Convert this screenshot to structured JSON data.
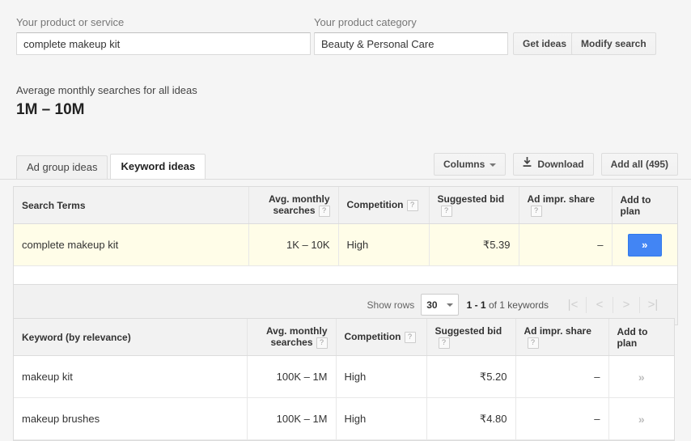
{
  "search_form": {
    "product_label": "Your product or service",
    "product_value": "complete makeup kit",
    "category_label": "Your product category",
    "category_value": "Beauty & Personal Care",
    "get_ideas_label": "Get ideas",
    "modify_search_label": "Modify search"
  },
  "summary": {
    "label": "Average monthly searches for all ideas",
    "value": "1M – 10M"
  },
  "tabs": [
    {
      "label": "Ad group ideas",
      "active": false
    },
    {
      "label": "Keyword ideas",
      "active": true
    }
  ],
  "toolbar": {
    "columns_label": "Columns",
    "download_label": "Download",
    "add_all_label": "Add all (495)"
  },
  "search_terms_table": {
    "columns": [
      "Search Terms",
      "Avg. monthly",
      "searches",
      "Competition",
      "Suggested bid",
      "Ad impr. share",
      "Add to plan"
    ],
    "help_glyph": "?",
    "rows": [
      {
        "keyword": "complete makeup kit",
        "avg_monthly_searches": "1K – 10K",
        "competition": "High",
        "suggested_bid": "₹5.39",
        "ad_impr_share": "–",
        "add_to_plan": "»"
      }
    ]
  },
  "pagination": {
    "show_rows_label": "Show rows",
    "rows_per_page": "30",
    "range_prefix": "1 - 1",
    "range_suffix": "of 1 keywords",
    "first_icon": "|<",
    "prev_icon": "<",
    "next_icon": ">",
    "last_icon": ">|"
  },
  "keyword_ideas_table": {
    "columns": [
      "Keyword (by relevance)",
      "Avg. monthly",
      "searches",
      "Competition",
      "Suggested bid",
      "Ad impr. share",
      "Add to plan"
    ],
    "help_glyph": "?",
    "rows": [
      {
        "keyword": "makeup kit",
        "avg_monthly_searches": "100K – 1M",
        "competition": "High",
        "suggested_bid": "₹5.20",
        "ad_impr_share": "–",
        "add_to_plan": "»"
      },
      {
        "keyword": "makeup brushes",
        "avg_monthly_searches": "100K – 1M",
        "competition": "High",
        "suggested_bid": "₹4.80",
        "ad_impr_share": "–",
        "add_to_plan": "»"
      }
    ]
  },
  "colors": {
    "accent_blue": "#4285f4",
    "row_highlight": "#fffde8",
    "page_background": "#f5f5f5"
  }
}
